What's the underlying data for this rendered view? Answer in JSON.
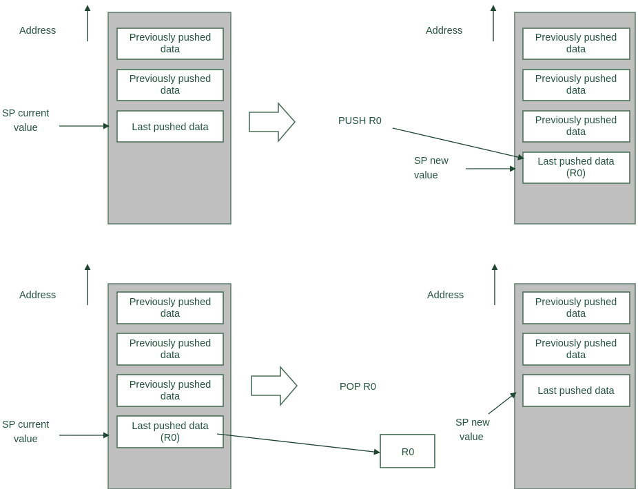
{
  "figure": {
    "title": "Stack PUSH and POP operation diagram",
    "colors": {
      "stack_fill": "#bfbfbf",
      "slot_fill": "#ffffff",
      "text": "#22543d",
      "line": "#1d4730",
      "slot_border": "#4a7059"
    }
  },
  "panels": {
    "push_before": {
      "axis_label": "Address",
      "pointer_label_line1": "SP current",
      "pointer_label_line2": "value",
      "slots": [
        {
          "line1": "Previously pushed",
          "line2": "data"
        },
        {
          "line1": "Previously pushed",
          "line2": "data"
        },
        {
          "line1": "Last pushed data",
          "line2": ""
        }
      ]
    },
    "push_after": {
      "axis_label": "Address",
      "operation_label": "PUSH R0",
      "pointer_label_line1": "SP new",
      "pointer_label_line2": "value",
      "slots": [
        {
          "line1": "Previously pushed",
          "line2": "data"
        },
        {
          "line1": "Previously pushed",
          "line2": "data"
        },
        {
          "line1": "Previously pushed",
          "line2": "data"
        },
        {
          "line1": "Last pushed data",
          "line2": "(R0)"
        }
      ]
    },
    "pop_before": {
      "axis_label": "Address",
      "pointer_label_line1": "SP current",
      "pointer_label_line2": "value",
      "slots": [
        {
          "line1": "Previously pushed",
          "line2": "data"
        },
        {
          "line1": "Previously pushed",
          "line2": "data"
        },
        {
          "line1": "Previously pushed",
          "line2": "data"
        },
        {
          "line1": "Last pushed data",
          "line2": "(R0)"
        }
      ]
    },
    "pop_after": {
      "axis_label": "Address",
      "operation_label": "POP R0",
      "pointer_label_line1": "SP new",
      "pointer_label_line2": "value",
      "register_box_label": "R0",
      "slots": [
        {
          "line1": "Previously pushed",
          "line2": "data"
        },
        {
          "line1": "Previously pushed",
          "line2": "data"
        },
        {
          "line1": "Last pushed data",
          "line2": ""
        }
      ]
    }
  }
}
